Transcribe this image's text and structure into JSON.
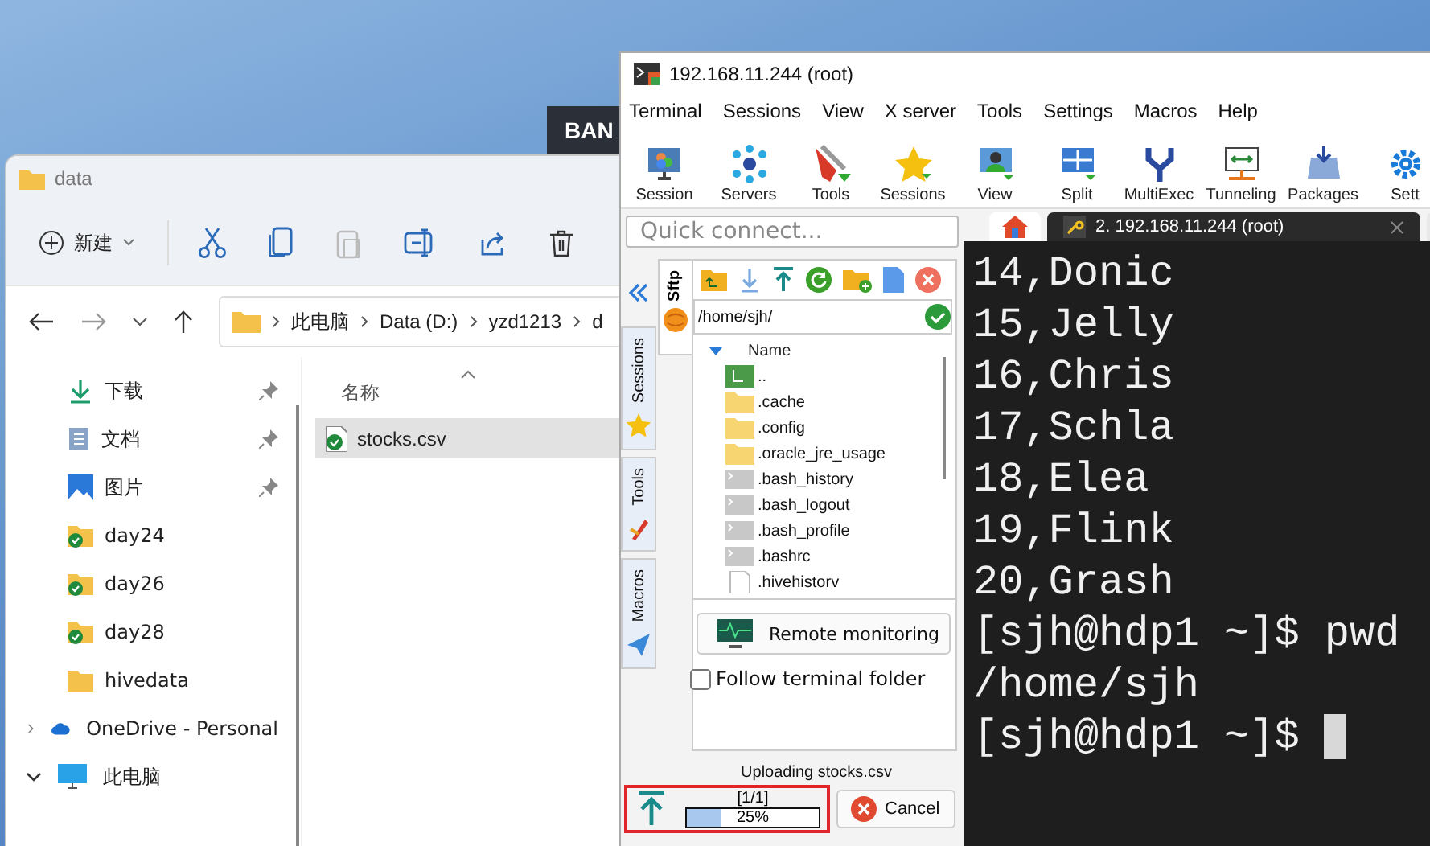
{
  "desktop": {
    "banner_text": "BAN"
  },
  "explorer": {
    "title": "data",
    "new_button": "新建",
    "breadcrumb": [
      "此电脑",
      "Data (D:)",
      "yzd1213",
      "d"
    ],
    "quick_access": [
      {
        "label": "下载",
        "kind": "download",
        "pinned": true
      },
      {
        "label": "文档",
        "kind": "document",
        "pinned": true
      },
      {
        "label": "图片",
        "kind": "picture",
        "pinned": true
      },
      {
        "label": "day24",
        "kind": "synced",
        "pinned": false
      },
      {
        "label": "day26",
        "kind": "synced",
        "pinned": false
      },
      {
        "label": "day28",
        "kind": "synced",
        "pinned": false
      },
      {
        "label": "hivedata",
        "kind": "folder",
        "pinned": false
      }
    ],
    "roots": [
      {
        "label": "OneDrive - Personal",
        "kind": "cloud",
        "expanded": false
      },
      {
        "label": "此电脑",
        "kind": "pc",
        "expanded": true
      }
    ],
    "column_header": "名称",
    "files": [
      {
        "name": "stocks.csv",
        "selected": true
      }
    ]
  },
  "session_window": {
    "title": "192.168.11.244 (root)",
    "menu": [
      "Terminal",
      "Sessions",
      "View",
      "X server",
      "Tools",
      "Settings",
      "Macros",
      "Help"
    ],
    "toolbar": [
      {
        "label": "Session",
        "kind": "session"
      },
      {
        "label": "Servers",
        "kind": "servers"
      },
      {
        "label": "Tools",
        "kind": "tools"
      },
      {
        "label": "Sessions",
        "kind": "sessions"
      },
      {
        "label": "View",
        "kind": "view"
      },
      {
        "label": "Split",
        "kind": "split"
      },
      {
        "label": "MultiExec",
        "kind": "multiexec"
      },
      {
        "label": "Tunneling",
        "kind": "tunneling"
      },
      {
        "label": "Packages",
        "kind": "packages"
      },
      {
        "label": "Sett",
        "kind": "settings"
      }
    ],
    "quick_connect": {
      "placeholder": "Quick connect..."
    },
    "side_tabs": [
      {
        "label": "Sessions",
        "kind": "sessions"
      },
      {
        "label": "Tools",
        "kind": "tools"
      },
      {
        "label": "Macros",
        "kind": "macros"
      }
    ],
    "sftp": {
      "tab_label": "Sftp",
      "path": "/home/sjh/",
      "column_header": "Name",
      "files": [
        {
          "name": "..",
          "kind": "parent"
        },
        {
          "name": ".cache",
          "kind": "folder"
        },
        {
          "name": ".config",
          "kind": "folder"
        },
        {
          "name": ".oracle_jre_usage",
          "kind": "folder"
        },
        {
          "name": ".bash_history",
          "kind": "script"
        },
        {
          "name": ".bash_logout",
          "kind": "script"
        },
        {
          "name": ".bash_profile",
          "kind": "script"
        },
        {
          "name": ".bashrc",
          "kind": "script"
        },
        {
          "name": ".hivehistorv",
          "kind": "text"
        }
      ],
      "remote_monitoring": "Remote monitoring",
      "follow_terminal": {
        "label": "Follow terminal folder",
        "checked": false
      },
      "transfer": {
        "caption": "Uploading stocks.csv",
        "count": "[1/1]",
        "level": 0.25,
        "percent": "25%",
        "cancel": "Cancel"
      }
    },
    "terminal": {
      "tabs": [
        {
          "kind": "home",
          "selected": false
        },
        {
          "kind": "session",
          "label": "2. 192.168.11.244 (root)",
          "selected": true
        },
        {
          "kind": "session",
          "selected": false
        }
      ],
      "lines": [
        "14,Donic",
        "15,Jelly",
        "16,Chris",
        "17,Schla",
        "18,Elea",
        "19,Flink",
        "20,Grash",
        "[sjh@hdp1 ~]$ pwd",
        "/home/sjh",
        "[sjh@hdp1 ~]$ "
      ],
      "cursor_visible": true
    }
  }
}
